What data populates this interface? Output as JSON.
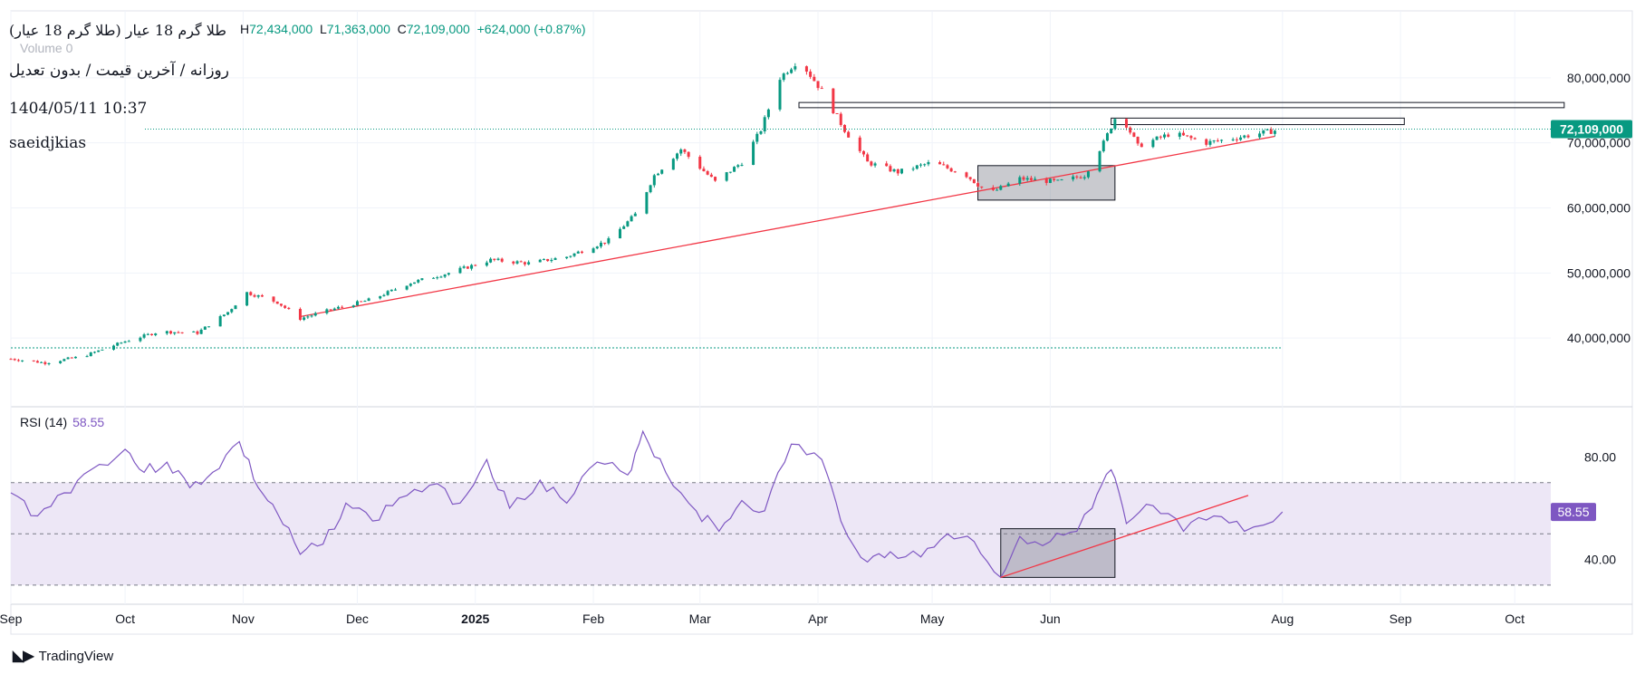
{
  "header": {
    "title": "طلا گرم 18 عیار (طلا گرم 18 عیار)",
    "ohlc_items": [
      {
        "k": "H",
        "v": "72,434,000"
      },
      {
        "k": "L",
        "v": "71,363,000"
      },
      {
        "k": "C",
        "v": "72,109,000"
      }
    ],
    "change": "+624,000 (+0.87%)",
    "volume_label": "Volume",
    "volume_value": "0",
    "subtitle": "روزانه / آخرین قیمت / بدون تعدیل",
    "timestamp": "1404/05/11 10:37",
    "author": "saeidjkias"
  },
  "footer": {
    "brand": "TradingView"
  },
  "colors": {
    "up": "#089981",
    "down": "#f23645",
    "rsi": "#7e57c2",
    "rsi_band": "#ede7f6",
    "trend": "#f23645",
    "last_price": "#089981"
  },
  "rsi": {
    "label": "RSI (14)",
    "value": "58.55"
  },
  "chart_data": [
    {
      "type": "candlestick",
      "ylim": [
        30000000,
        90000000
      ],
      "y_ticks": [
        "40,000,000",
        "50,000,000",
        "60,000,000",
        "70,000,000",
        "80,000,000"
      ],
      "y_tick_values": [
        40000000,
        50000000,
        60000000,
        70000000,
        80000000
      ],
      "x_ticks": [
        "Sep",
        "Oct",
        "Nov",
        "Dec",
        "2025",
        "Feb",
        "Mar",
        "Apr",
        "May",
        "Jun",
        "Aug",
        "Sep",
        "Oct"
      ],
      "x_tick_dates": [
        "2024-09-01",
        "2024-10-01",
        "2024-11-01",
        "2024-12-01",
        "2025-01-01",
        "2025-02-01",
        "2025-03-01",
        "2025-04-01",
        "2025-05-01",
        "2025-06-01",
        "2025-08-01",
        "2025-09-01",
        "2025-10-01"
      ],
      "last_price_label": "72,109,000",
      "last_price": 72109000,
      "close_path": [
        [
          "2024-09-01",
          36800000
        ],
        [
          "2024-09-10",
          36200000
        ],
        [
          "2024-09-20",
          37200000
        ],
        [
          "2024-10-01",
          39500000
        ],
        [
          "2024-10-10",
          41000000
        ],
        [
          "2024-10-20",
          40800000
        ],
        [
          "2024-10-28",
          44000000
        ],
        [
          "2024-11-02",
          47000000
        ],
        [
          "2024-11-10",
          45500000
        ],
        [
          "2024-11-16",
          43000000
        ],
        [
          "2024-11-25",
          44500000
        ],
        [
          "2024-12-05",
          46000000
        ],
        [
          "2024-12-15",
          48500000
        ],
        [
          "2024-12-25",
          50000000
        ],
        [
          "2025-01-05",
          52000000
        ],
        [
          "2025-01-15",
          51500000
        ],
        [
          "2025-01-25",
          52500000
        ],
        [
          "2025-02-05",
          55000000
        ],
        [
          "2025-02-12",
          59000000
        ],
        [
          "2025-02-17",
          65000000
        ],
        [
          "2025-02-24",
          69000000
        ],
        [
          "2025-03-05",
          64000000
        ],
        [
          "2025-03-12",
          67000000
        ],
        [
          "2025-03-17",
          72000000
        ],
        [
          "2025-03-22",
          80000000
        ],
        [
          "2025-03-27",
          82800000
        ],
        [
          "2025-04-02",
          78000000
        ],
        [
          "2025-04-08",
          72000000
        ],
        [
          "2025-04-14",
          67000000
        ],
        [
          "2025-04-22",
          65500000
        ],
        [
          "2025-05-01",
          67000000
        ],
        [
          "2025-05-10",
          65000000
        ],
        [
          "2025-05-16",
          62200000
        ],
        [
          "2025-05-24",
          64500000
        ],
        [
          "2025-06-03",
          64000000
        ],
        [
          "2025-06-10",
          65000000
        ],
        [
          "2025-06-15",
          70000000
        ],
        [
          "2025-06-19",
          75000000
        ],
        [
          "2025-06-24",
          69500000
        ],
        [
          "2025-07-03",
          71500000
        ],
        [
          "2025-07-12",
          70000000
        ],
        [
          "2025-07-20",
          70800000
        ],
        [
          "2025-08-01",
          72109000
        ]
      ],
      "trendline": [
        [
          "2024-11-16",
          43300000
        ],
        [
          "2025-07-30",
          71000000
        ]
      ],
      "horizontal_lines": [
        {
          "date_from": "2024-09-01",
          "date_to": "2025-08-01",
          "value": 38500000
        }
      ],
      "zones": [
        {
          "date_from": "2025-05-13",
          "date_to": "2025-06-18",
          "top": 66500000,
          "bottom": 61200000,
          "fill": true
        },
        {
          "date_from": "2025-03-27",
          "date_to": "2025-10-14",
          "top": 76200000,
          "bottom": 75400000,
          "fill": false
        },
        {
          "date_from": "2025-06-17",
          "date_to": "2025-09-02",
          "top": 73800000,
          "bottom": 72800000,
          "fill": false
        }
      ]
    },
    {
      "type": "line",
      "name": "RSI (14)",
      "ylim": [
        25,
        95
      ],
      "y_ticks": [
        "40.00",
        "80.00"
      ],
      "y_tick_values": [
        40,
        80
      ],
      "bands": [
        30,
        50,
        70
      ],
      "last_value_label": "58.55",
      "series": [
        [
          "2024-09-01",
          66
        ],
        [
          "2024-09-08",
          57
        ],
        [
          "2024-09-15",
          66
        ],
        [
          "2024-09-22",
          75
        ],
        [
          "2024-10-01",
          83
        ],
        [
          "2024-10-06",
          74
        ],
        [
          "2024-10-12",
          78
        ],
        [
          "2024-10-18",
          68
        ],
        [
          "2024-10-24",
          74
        ],
        [
          "2024-10-31",
          86
        ],
        [
          "2024-11-05",
          68
        ],
        [
          "2024-11-10",
          58
        ],
        [
          "2024-11-16",
          42
        ],
        [
          "2024-11-22",
          46
        ],
        [
          "2024-11-28",
          62
        ],
        [
          "2024-12-05",
          55
        ],
        [
          "2024-12-12",
          64
        ],
        [
          "2024-12-20",
          69
        ],
        [
          "2024-12-28",
          62
        ],
        [
          "2025-01-04",
          79
        ],
        [
          "2025-01-10",
          60
        ],
        [
          "2025-01-18",
          71
        ],
        [
          "2025-01-25",
          62
        ],
        [
          "2025-02-02",
          78
        ],
        [
          "2025-02-10",
          73
        ],
        [
          "2025-02-14",
          90
        ],
        [
          "2025-02-20",
          74
        ],
        [
          "2025-02-28",
          59
        ],
        [
          "2025-03-06",
          51
        ],
        [
          "2025-03-12",
          63
        ],
        [
          "2025-03-18",
          59
        ],
        [
          "2025-03-25",
          85
        ],
        [
          "2025-04-02",
          79
        ],
        [
          "2025-04-07",
          55
        ],
        [
          "2025-04-14",
          39
        ],
        [
          "2025-04-20",
          43
        ],
        [
          "2025-04-28",
          41
        ],
        [
          "2025-05-05",
          50
        ],
        [
          "2025-05-12",
          47
        ],
        [
          "2025-05-19",
          33
        ],
        [
          "2025-05-24",
          49
        ],
        [
          "2025-06-01",
          47
        ],
        [
          "2025-06-08",
          51
        ],
        [
          "2025-06-12",
          60
        ],
        [
          "2025-06-17",
          75
        ],
        [
          "2025-06-21",
          54
        ],
        [
          "2025-06-28",
          61
        ],
        [
          "2025-07-06",
          51
        ],
        [
          "2025-07-14",
          57
        ],
        [
          "2025-07-22",
          51
        ],
        [
          "2025-08-01",
          58.55
        ]
      ],
      "trendline": [
        [
          "2025-05-19",
          33
        ],
        [
          "2025-07-23",
          65
        ]
      ],
      "zones": [
        {
          "date_from": "2025-05-19",
          "date_to": "2025-06-18",
          "top": 52,
          "bottom": 33
        }
      ]
    }
  ]
}
